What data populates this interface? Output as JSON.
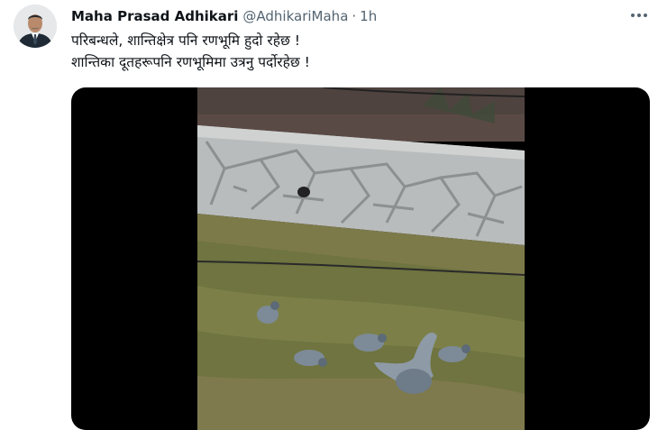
{
  "tweet": {
    "display_name": "Maha Prasad Adhikari",
    "handle": "@AdhikariMaha",
    "separator": "·",
    "time": "1h",
    "text_lines": [
      "परिबन्धले, शान्तिक्षेत्र पनि रणभूमि हुदो रहेछ !",
      "शान्तिका दूतहरूपनि रणभूमिमा उत्रनु पर्दोरहेछ !"
    ]
  },
  "icons": {
    "more": "more-horizontal-icon",
    "avatar": "profile-photo"
  },
  "colors": {
    "text": "#0f1419",
    "secondary": "#536471",
    "media_bg": "#000000"
  }
}
